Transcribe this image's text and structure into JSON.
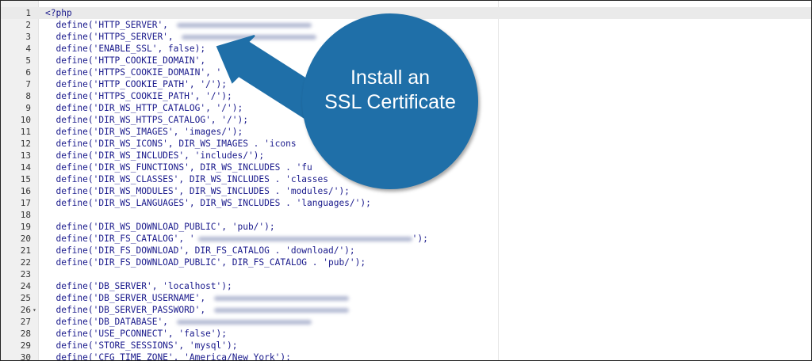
{
  "callout": {
    "line1": "Install an",
    "line2": "SSL Certificate",
    "color": "#1f6fa8"
  },
  "editor": {
    "active_line": 1,
    "lines": [
      {
        "n": "1",
        "text": "<?php"
      },
      {
        "n": "2",
        "text": "  define('HTTP_SERVER', ",
        "blur": true
      },
      {
        "n": "3",
        "text": "  define('HTTPS_SERVER', ",
        "blur": true
      },
      {
        "n": "4",
        "text": "  define('ENABLE_SSL', false);"
      },
      {
        "n": "5",
        "text": "  define('HTTP_COOKIE_DOMAIN', "
      },
      {
        "n": "6",
        "text": "  define('HTTPS_COOKIE_DOMAIN', '"
      },
      {
        "n": "7",
        "text": "  define('HTTP_COOKIE_PATH', '/');"
      },
      {
        "n": "8",
        "text": "  define('HTTPS_COOKIE_PATH', '/');"
      },
      {
        "n": "9",
        "text": "  define('DIR_WS_HTTP_CATALOG', '/');"
      },
      {
        "n": "10",
        "text": "  define('DIR_WS_HTTPS_CATALOG', '/');"
      },
      {
        "n": "11",
        "text": "  define('DIR_WS_IMAGES', 'images/');"
      },
      {
        "n": "12",
        "text": "  define('DIR_WS_ICONS', DIR_WS_IMAGES . 'icons"
      },
      {
        "n": "13",
        "text": "  define('DIR_WS_INCLUDES', 'includes/');"
      },
      {
        "n": "14",
        "text": "  define('DIR_WS_FUNCTIONS', DIR_WS_INCLUDES . 'fu"
      },
      {
        "n": "15",
        "text": "  define('DIR_WS_CLASSES', DIR_WS_INCLUDES . 'classes"
      },
      {
        "n": "16",
        "text": "  define('DIR_WS_MODULES', DIR_WS_INCLUDES . 'modules/');"
      },
      {
        "n": "17",
        "text": "  define('DIR_WS_LANGUAGES', DIR_WS_INCLUDES . 'languages/');"
      },
      {
        "n": "18",
        "text": ""
      },
      {
        "n": "19",
        "text": "  define('DIR_WS_DOWNLOAD_PUBLIC', 'pub/');"
      },
      {
        "n": "20",
        "text": "  define('DIR_FS_CATALOG', '",
        "blur": true,
        "tail": "');"
      },
      {
        "n": "21",
        "text": "  define('DIR_FS_DOWNLOAD', DIR_FS_CATALOG . 'download/');"
      },
      {
        "n": "22",
        "text": "  define('DIR_FS_DOWNLOAD_PUBLIC', DIR_FS_CATALOG . 'pub/');"
      },
      {
        "n": "23",
        "text": ""
      },
      {
        "n": "24",
        "text": "  define('DB_SERVER', 'localhost');"
      },
      {
        "n": "25",
        "text": "  define('DB_SERVER_USERNAME', ",
        "blur": true
      },
      {
        "n": "26",
        "text": "  define('DB_SERVER_PASSWORD', ",
        "blur": true,
        "fold": true
      },
      {
        "n": "27",
        "text": "  define('DB_DATABASE', ",
        "blur": true
      },
      {
        "n": "28",
        "text": "  define('USE_PCONNECT', 'false');"
      },
      {
        "n": "29",
        "text": "  define('STORE_SESSIONS', 'mysql');"
      },
      {
        "n": "30",
        "text": "  define('CFG_TIME_ZONE', 'America/New_York');"
      }
    ]
  }
}
